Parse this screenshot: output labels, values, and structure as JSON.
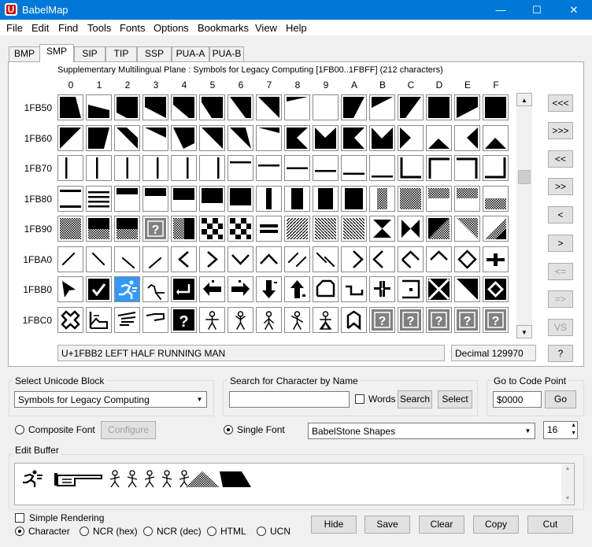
{
  "window": {
    "title": "BabelMap",
    "app_icon": "U"
  },
  "menu": [
    "File",
    "Edit",
    "Find",
    "Tools",
    "Fonts",
    "Options",
    "Bookmarks",
    "View",
    "Help"
  ],
  "tabs": [
    "BMP",
    "SMP",
    "SIP",
    "TIP",
    "SSP",
    "PUA-A",
    "PUA-B"
  ],
  "active_tab": 1,
  "grid": {
    "caption": "Supplementary Multilingual Plane : Symbols for Legacy Computing [1FB00..1FBFF] (212 characters)",
    "columns": [
      "0",
      "1",
      "2",
      "3",
      "4",
      "5",
      "6",
      "7",
      "8",
      "9",
      "A",
      "B",
      "C",
      "D",
      "E",
      "F"
    ],
    "rows": [
      "1FB50",
      "1FB60",
      "1FB70",
      "1FB80",
      "1FB90",
      "1FBA0",
      "1FBB0",
      "1FBC0"
    ],
    "selected": "1FBB2"
  },
  "nav_buttons": [
    "<<<",
    ">>>",
    "<<",
    ">>",
    "<",
    ">",
    "<=",
    "=>",
    "VS",
    "?"
  ],
  "status": {
    "char_name": "U+1FBB2 LEFT HALF RUNNING MAN",
    "decimal": "Decimal 129970"
  },
  "block_group": {
    "label": "Select Unicode Block",
    "value": "Symbols for Legacy Computing"
  },
  "search_group": {
    "label": "Search for Character by Name",
    "value": "",
    "words_label": "Words",
    "search_btn": "Search",
    "select_btn": "Select"
  },
  "goto_group": {
    "label": "Go to Code Point",
    "value": "$0000",
    "go_btn": "Go"
  },
  "font_options": {
    "composite_label": "Composite Font",
    "configure_btn": "Configure",
    "single_label": "Single Font",
    "font_value": "BabelStone Shapes",
    "size_value": "16"
  },
  "edit_buffer": {
    "label": "Edit Buffer"
  },
  "bottom": {
    "simple_rendering": "Simple Rendering",
    "radios": [
      "Character",
      "NCR (hex)",
      "NCR (dec)",
      "HTML",
      "UCN"
    ],
    "buttons": [
      "Hide",
      "Save",
      "Clear",
      "Copy",
      "Cut"
    ]
  }
}
